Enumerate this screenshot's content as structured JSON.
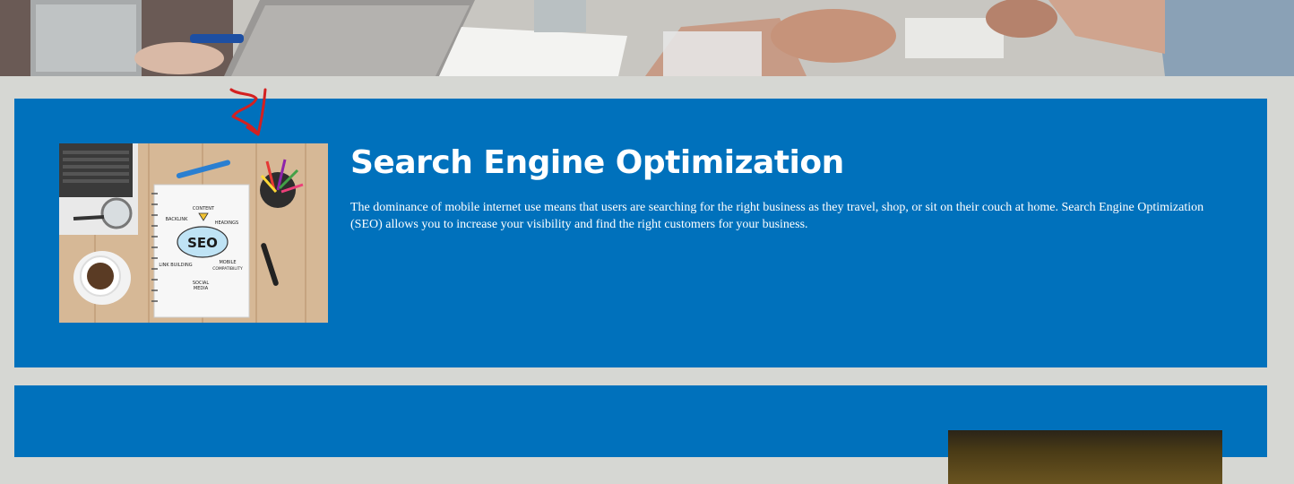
{
  "hero": {
    "image": "meeting-table-photo"
  },
  "services": [
    {
      "title": "Search Engine Optimization",
      "description": "The dominance of mobile internet use means that users are searching for the right business as they travel, shop, or sit on their couch at home. Search Engine Optimization (SEO) allows you to increase your visibility and find the right customers for your business.",
      "image": {
        "center_label": "SEO",
        "labels": [
          "CONTENT",
          "BACKLINK",
          "HEADINGS",
          "LINK BUILDING",
          "MOBILE COMPATIBILITY",
          "SOCIAL MEDIA"
        ]
      }
    }
  ],
  "colors": {
    "page_background": "#d6d7d3",
    "card_background": "#0071bc",
    "annotation": "#d42020"
  },
  "icons": {
    "annotation": "red-arrow-icon"
  }
}
